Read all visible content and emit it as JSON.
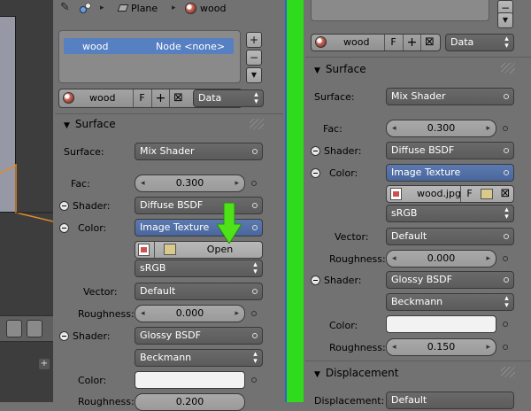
{
  "header": {
    "breadcrumb_object": "Plane",
    "breadcrumb_material": "wood"
  },
  "left": {
    "material_list_item_name": "wood",
    "material_list_item_node": "Node <none>",
    "material_field_value": "wood",
    "fake_user_label": "F",
    "link_select_value": "Data",
    "surface_section": "Surface",
    "surface_label": "Surface:",
    "surface_value": "Mix Shader",
    "fac_label": "Fac:",
    "fac_value": "0.300",
    "shader1_label": "Shader:",
    "shader1_value": "Diffuse BSDF",
    "color_label": "Color:",
    "color_value": "Image Texture",
    "open_label": "Open",
    "colorspace_value": "sRGB",
    "vector_label": "Vector:",
    "vector_value": "Default",
    "roughness_label": "Roughness:",
    "roughness_value": "0.000",
    "shader2_label": "Shader:",
    "shader2_value": "Glossy BSDF",
    "distribution_value": "Beckmann",
    "color2_label": "Color:",
    "roughness2_label": "Roughness:",
    "roughness2_value": "0.200"
  },
  "right": {
    "material_field_value": "wood",
    "fake_user_label": "F",
    "link_select_value": "Data",
    "surface_section": "Surface",
    "surface_label": "Surface:",
    "surface_value": "Mix Shader",
    "fac_label": "Fac:",
    "fac_value": "0.300",
    "shader1_label": "Shader:",
    "shader1_value": "Diffuse BSDF",
    "color_label": "Color:",
    "color_value": "Image Texture",
    "image_name": "wood.jpg",
    "image_fake_user": "F",
    "colorspace_value": "sRGB",
    "vector_label": "Vector:",
    "vector_value": "Default",
    "roughness_label": "Roughness:",
    "roughness_value": "0.000",
    "shader2_label": "Shader:",
    "shader2_value": "Glossy BSDF",
    "distribution_value": "Beckmann",
    "color2_label": "Color:",
    "roughness2_label": "Roughness:",
    "roughness2_value": "0.150",
    "displacement_section": "Displacement",
    "displacement_label": "Displacement:",
    "displacement_value": "Default"
  },
  "colors": {
    "divider_green": "#2fdb1d",
    "selection_blue": "#5c7ab0",
    "arrow_green": "#4fe21a"
  }
}
